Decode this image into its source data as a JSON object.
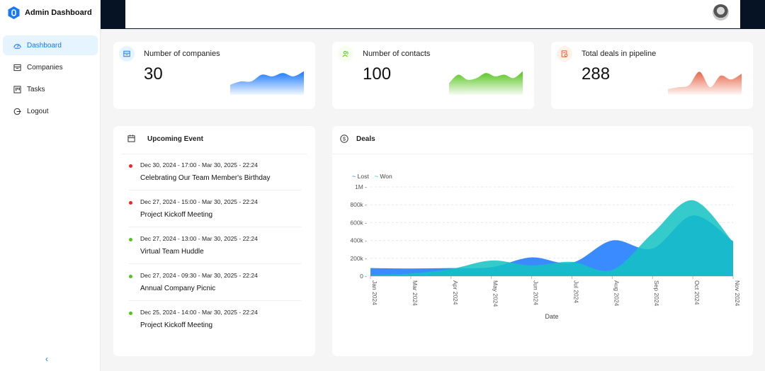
{
  "app": {
    "title": "Admin Dashboard"
  },
  "sidebar": {
    "items": [
      {
        "label": "Dashboard",
        "icon": "dashboard-icon",
        "active": true
      },
      {
        "label": "Companies",
        "icon": "shop-icon",
        "active": false
      },
      {
        "label": "Tasks",
        "icon": "project-icon",
        "active": false
      },
      {
        "label": "Logout",
        "icon": "logout-icon",
        "active": false
      }
    ],
    "collapse_label": "‹"
  },
  "stats": [
    {
      "label": "Number of companies",
      "value": "30",
      "icon": "shop-icon",
      "color": "#1677ff"
    },
    {
      "label": "Number of contacts",
      "value": "100",
      "icon": "team-icon",
      "color": "#52c41a"
    },
    {
      "label": "Total deals in pipeline",
      "value": "288",
      "icon": "audit-icon",
      "color": "#fa541c"
    }
  ],
  "events": {
    "title": "Upcoming Event",
    "items": [
      {
        "date": "Dec 30, 2024 - 17:00 - Mar 30, 2025 - 22:24",
        "title": "Celebrating Our Team Member's Birthday",
        "dot_color": "#f5222d"
      },
      {
        "date": "Dec 27, 2024 - 15:00 - Mar 30, 2025 - 22:24",
        "title": "Project Kickoff Meeting",
        "dot_color": "#f5222d"
      },
      {
        "date": "Dec 27, 2024 - 13:00 - Mar 30, 2025 - 22:24",
        "title": "Virtual Team Huddle",
        "dot_color": "#52c41a"
      },
      {
        "date": "Dec 27, 2024 - 09:30 - Mar 30, 2025 - 22:24",
        "title": "Annual Company Picnic",
        "dot_color": "#52c41a"
      },
      {
        "date": "Dec 25, 2024 - 14:00 - Mar 30, 2025 - 22:24",
        "title": "Project Kickoff Meeting",
        "dot_color": "#52c41a"
      }
    ]
  },
  "deals": {
    "title": "Deals"
  },
  "chart_data": {
    "type": "area",
    "xlabel": "Date",
    "ylabel": "",
    "ylim": [
      0,
      1000000
    ],
    "yticks": [
      "0",
      "200k",
      "400k",
      "600k",
      "800k",
      "1M"
    ],
    "x": [
      "Jan 2024",
      "Mar 2024",
      "Apr 2024",
      "May 2024",
      "Jun 2024",
      "Jul 2024",
      "Aug 2024",
      "Sep 2024",
      "Oct 2024",
      "Nov 2024"
    ],
    "series": [
      {
        "name": "Lost",
        "color": "#1677ff",
        "values": [
          90000,
          85000,
          90000,
          100000,
          210000,
          150000,
          400000,
          310000,
          680000,
          390000
        ]
      },
      {
        "name": "Won",
        "color": "#13c2c2",
        "values": [
          10000,
          30000,
          80000,
          175000,
          120000,
          160000,
          70000,
          480000,
          850000,
          380000
        ]
      }
    ],
    "legend_position": "top-left",
    "grid": true
  },
  "sparklines": [
    {
      "color": "#1677ff",
      "values": [
        6,
        8,
        8,
        12,
        11,
        13,
        11,
        14
      ]
    },
    {
      "color": "#52c41a",
      "values": [
        7,
        12,
        9,
        10,
        13,
        11,
        12,
        10,
        14
      ]
    },
    {
      "color": "#e8684a",
      "values": [
        3,
        4,
        5,
        12,
        4,
        10,
        8,
        11
      ]
    }
  ]
}
